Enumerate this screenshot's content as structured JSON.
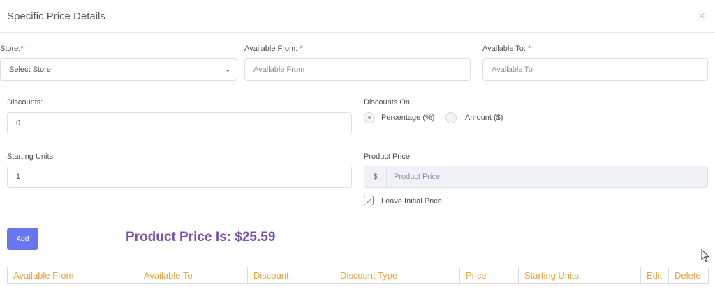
{
  "modal": {
    "title": "Specific Price Details",
    "close_symbol": "×"
  },
  "form": {
    "store": {
      "label": "Store:",
      "required_mark": "*",
      "value": "Select Store"
    },
    "available_from": {
      "label": "Available From:",
      "required_mark": "*",
      "placeholder": "Available From"
    },
    "available_to": {
      "label": "Available To:",
      "required_mark": "*",
      "placeholder": "Available To"
    },
    "discounts": {
      "label": "Discounts:",
      "value": "0"
    },
    "discounts_on": {
      "label": "Discounts On:",
      "options": [
        {
          "label": "Percentage (%)",
          "checked": true
        },
        {
          "label": "Amount ($)",
          "checked": false
        }
      ]
    },
    "starting_units": {
      "label": "Starting Units:",
      "value": "1"
    },
    "product_price": {
      "label": "Product Price:",
      "prefix": "$",
      "placeholder": "Product Price"
    },
    "leave_initial_price": {
      "label": "Leave Initial Price",
      "checked": true
    }
  },
  "actions": {
    "add_label": "Add"
  },
  "summary": {
    "product_price_text": "Product Price Is: $25.59"
  },
  "table": {
    "headers": [
      "Available From",
      "Available To",
      "Discount",
      "Discount Type",
      "Price",
      "Starting Units",
      "Edit",
      "Delete"
    ]
  },
  "colors": {
    "accent": "#6777ef",
    "price_title": "#7b52ab",
    "table_header": "#f0a23a",
    "required": "#e53935"
  }
}
